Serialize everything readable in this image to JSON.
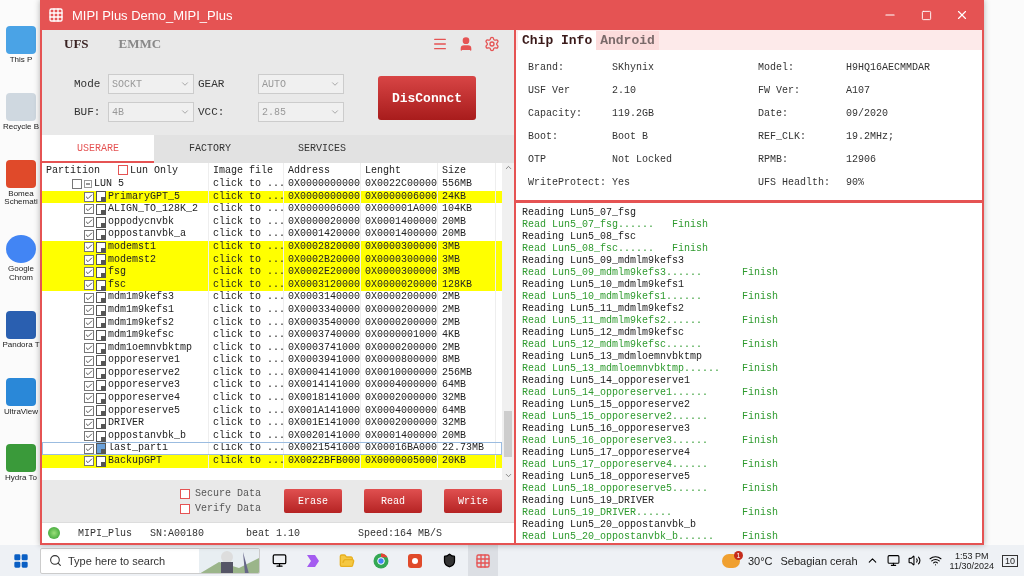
{
  "desktop_icons": [
    {
      "label": "This P"
    },
    {
      "label": "Recycle B"
    },
    {
      "label": "Bomea Schemati"
    },
    {
      "label": "Google Chrom"
    },
    {
      "label": "Pandora T"
    },
    {
      "label": "UltraView"
    },
    {
      "label": "Hydra To"
    }
  ],
  "window": {
    "title": "MIPI Plus Demo_MIPI_Plus"
  },
  "device_tabs": [
    {
      "label": "UFS",
      "selected": true
    },
    {
      "label": "EMMC",
      "selected": false
    }
  ],
  "settings": [
    {
      "label": "Mode",
      "value": "SOCKT",
      "disabled": true
    },
    {
      "label": "GEAR",
      "value": "AUTO",
      "disabled": true
    },
    {
      "label": "BUF:",
      "value": "4B",
      "disabled": true
    },
    {
      "label": "VCC:",
      "value": "2.85",
      "disabled": true
    }
  ],
  "connect_button": "DisConnct",
  "area_tabs": [
    {
      "label": "USERARE",
      "selected": true
    },
    {
      "label": "FACTORY",
      "selected": false
    },
    {
      "label": "SERVICES",
      "selected": false
    }
  ],
  "table": {
    "columns": [
      "Partition",
      "Image file",
      "Address",
      "Lenght",
      "Size"
    ],
    "lun_only": {
      "label": "Lun Only",
      "checked": false
    },
    "lun": {
      "label": "LUN 5",
      "checked": false,
      "expanded": true,
      "image": "click to ...",
      "address": "0X0000000000",
      "length": "0X0022C00000",
      "size": "556MB",
      "children": [
        {
          "name": "PrimaryGPT_5",
          "image": "click to ...",
          "address": "0X0000000000",
          "length": "0X0000006000",
          "size": "24KB",
          "checked": true,
          "highlighted": true,
          "selected": false
        },
        {
          "name": "ALIGN_TO_128K_2",
          "image": "click to ...",
          "address": "0X0000006000",
          "length": "0X000001A000",
          "size": "104KB",
          "checked": true,
          "highlighted": false,
          "selected": false
        },
        {
          "name": "oppodycnvbk",
          "image": "click to ...",
          "address": "0X0000020000",
          "length": "0X0001400000",
          "size": "20MB",
          "checked": true,
          "highlighted": false,
          "selected": false
        },
        {
          "name": "oppostanvbk_a",
          "image": "click to ...",
          "address": "0X0001420000",
          "length": "0X0001400000",
          "size": "20MB",
          "checked": true,
          "highlighted": false,
          "selected": false
        },
        {
          "name": "modemst1",
          "image": "click to ...",
          "address": "0X0002820000",
          "length": "0X0000300000",
          "size": "3MB",
          "checked": true,
          "highlighted": true,
          "selected": false
        },
        {
          "name": "modemst2",
          "image": "click to ...",
          "address": "0X0002B20000",
          "length": "0X0000300000",
          "size": "3MB",
          "checked": true,
          "highlighted": true,
          "selected": false
        },
        {
          "name": "fsg",
          "image": "click to ...",
          "address": "0X0002E20000",
          "length": "0X0000300000",
          "size": "3MB",
          "checked": true,
          "highlighted": true,
          "selected": false
        },
        {
          "name": "fsc",
          "image": "click to ...",
          "address": "0X0003120000",
          "length": "0X0000020000",
          "size": "128KB",
          "checked": true,
          "highlighted": true,
          "selected": false
        },
        {
          "name": "mdm1m9kefs3",
          "image": "click to ...",
          "address": "0X0003140000",
          "length": "0X0000200000",
          "size": "2MB",
          "checked": true,
          "highlighted": false,
          "selected": false
        },
        {
          "name": "mdm1m9kefs1",
          "image": "click to ...",
          "address": "0X0003340000",
          "length": "0X0000200000",
          "size": "2MB",
          "checked": true,
          "highlighted": false,
          "selected": false
        },
        {
          "name": "mdm1m9kefs2",
          "image": "click to ...",
          "address": "0X0003540000",
          "length": "0X0000200000",
          "size": "2MB",
          "checked": true,
          "highlighted": false,
          "selected": false
        },
        {
          "name": "mdm1m9kefsc",
          "image": "click to ...",
          "address": "0X0003740000",
          "length": "0X0000001000",
          "size": "4KB",
          "checked": true,
          "highlighted": false,
          "selected": false
        },
        {
          "name": "mdm1oemnvbktmp",
          "image": "click to ...",
          "address": "0X0003741000",
          "length": "0X0000200000",
          "size": "2MB",
          "checked": true,
          "highlighted": false,
          "selected": false
        },
        {
          "name": "opporeserve1",
          "image": "click to ...",
          "address": "0X0003941000",
          "length": "0X0000800000",
          "size": "8MB",
          "checked": true,
          "highlighted": false,
          "selected": false
        },
        {
          "name": "opporeserve2",
          "image": "click to ...",
          "address": "0X0004141000",
          "length": "0X0010000000",
          "size": "256MB",
          "checked": true,
          "highlighted": false,
          "selected": false
        },
        {
          "name": "opporeserve3",
          "image": "click to ...",
          "address": "0X0014141000",
          "length": "0X0004000000",
          "size": "64MB",
          "checked": true,
          "highlighted": false,
          "selected": false
        },
        {
          "name": "opporeserve4",
          "image": "click to ...",
          "address": "0X0018141000",
          "length": "0X0002000000",
          "size": "32MB",
          "checked": true,
          "highlighted": false,
          "selected": false
        },
        {
          "name": "opporeserve5",
          "image": "click to ...",
          "address": "0X001A141000",
          "length": "0X0004000000",
          "size": "64MB",
          "checked": true,
          "highlighted": false,
          "selected": false
        },
        {
          "name": "DRIVER",
          "image": "click to ...",
          "address": "0X001E141000",
          "length": "0X0002000000",
          "size": "32MB",
          "checked": true,
          "highlighted": false,
          "selected": false
        },
        {
          "name": "oppostanvbk_b",
          "image": "click to ...",
          "address": "0X0020141000",
          "length": "0X0001400000",
          "size": "20MB",
          "checked": true,
          "highlighted": false,
          "selected": false
        },
        {
          "name": "last_parti",
          "image": "click to ...",
          "address": "0X0021541000",
          "length": "0X00016BA000",
          "size": "22.73MB",
          "checked": true,
          "highlighted": false,
          "selected": true
        },
        {
          "name": "BackupGPT",
          "image": "click to ...",
          "address": "0X0022BFB000",
          "length": "0X0000005000",
          "size": "20KB",
          "checked": true,
          "highlighted": true,
          "selected": false
        }
      ]
    }
  },
  "options": [
    {
      "label": "Secure Data",
      "checked": false
    },
    {
      "label": "Verify Data",
      "checked": false
    }
  ],
  "actions": [
    "Erase",
    "Read",
    "Write"
  ],
  "status_bar": {
    "connected": true,
    "device": "MIPI_Plus",
    "serial": "SN:A00180",
    "version": "beat 1.10",
    "speed": "Speed:164 MB/S"
  },
  "info_tabs": [
    {
      "label": "Chip Info",
      "selected": true
    },
    {
      "label": "Android",
      "selected": false
    }
  ],
  "chip_info": [
    {
      "label": "Brand:",
      "value": "SKhynix"
    },
    {
      "label": "Model:",
      "value": "H9HQ16AECMMDAR"
    },
    {
      "label": "USF Ver",
      "value": "2.10"
    },
    {
      "label": "FW Ver:",
      "value": "A107"
    },
    {
      "label": "Capacity:",
      "value": "119.2GB"
    },
    {
      "label": "Date:",
      "value": "09/2020"
    },
    {
      "label": "Boot:",
      "value": "Boot B"
    },
    {
      "label": "REF_CLK:",
      "value": "19.2MHz;"
    },
    {
      "label": "OTP",
      "value": "Not Locked"
    },
    {
      "label": "RPMB:",
      "value": "12906"
    },
    {
      "label": "WriteProtect:",
      "value": "Yes"
    },
    {
      "label": "UFS Headlth:",
      "value": "90%"
    }
  ],
  "log": [
    {
      "kind": "reading",
      "text": "Reading Lun5_07_fsg"
    },
    {
      "kind": "read",
      "text": "Read Lun5_07_fsg......",
      "status": "Finish"
    },
    {
      "kind": "reading",
      "text": "Reading Lun5_08_fsc"
    },
    {
      "kind": "read",
      "text": "Read Lun5_08_fsc......",
      "status": "Finish"
    },
    {
      "kind": "reading",
      "text": "Reading Lun5_09_mdmlm9kefs3"
    },
    {
      "kind": "read",
      "text": "Read Lun5_09_mdmlm9kefs3......",
      "status": "Finish"
    },
    {
      "kind": "reading",
      "text": "Reading Lun5_10_mdmlm9kefs1"
    },
    {
      "kind": "read",
      "text": "Read Lun5_10_mdmlm9kefs1......",
      "status": "Finish"
    },
    {
      "kind": "reading",
      "text": "Reading Lun5_11_mdmlm9kefs2"
    },
    {
      "kind": "read",
      "text": "Read Lun5_11_mdmlm9kefs2......",
      "status": "Finish"
    },
    {
      "kind": "reading",
      "text": "Reading Lun5_12_mdmlm9kefsc"
    },
    {
      "kind": "read",
      "text": "Read Lun5_12_mdmlm9kefsc......",
      "status": "Finish"
    },
    {
      "kind": "reading",
      "text": "Reading Lun5_13_mdmloemnvbktmp"
    },
    {
      "kind": "read",
      "text": "Read Lun5_13_mdmloemnvbktmp......",
      "status": "Finish"
    },
    {
      "kind": "reading",
      "text": "Reading Lun5_14_opporeserve1"
    },
    {
      "kind": "read",
      "text": "Read Lun5_14_opporeserve1......",
      "status": "Finish"
    },
    {
      "kind": "reading",
      "text": "Reading Lun5_15_opporeserve2"
    },
    {
      "kind": "read",
      "text": "Read Lun5_15_opporeserve2......",
      "status": "Finish"
    },
    {
      "kind": "reading",
      "text": "Reading Lun5_16_opporeserve3"
    },
    {
      "kind": "read",
      "text": "Read Lun5_16_opporeserve3......",
      "status": "Finish"
    },
    {
      "kind": "reading",
      "text": "Reading Lun5_17_opporeserve4"
    },
    {
      "kind": "read",
      "text": "Read Lun5_17_opporeserve4......",
      "status": "Finish"
    },
    {
      "kind": "reading",
      "text": "Reading Lun5_18_opporeserve5"
    },
    {
      "kind": "read",
      "text": "Read Lun5_18_opporeserve5......",
      "status": "Finish"
    },
    {
      "kind": "reading",
      "text": "Reading Lun5_19_DRIVER"
    },
    {
      "kind": "read",
      "text": "Read Lun5_19_DRIVER......",
      "status": "Finish"
    },
    {
      "kind": "reading",
      "text": "Reading Lun5_20_oppostanvbk_b"
    },
    {
      "kind": "read",
      "text": "Read Lun5_20_oppostanvbk_b......",
      "status": "Finish"
    }
  ],
  "taskbar": {
    "search_placeholder": "Type here to search",
    "weather": {
      "temperature": "30°C",
      "condition": "Sebagian cerah",
      "alert": "1"
    },
    "time": "1:53 PM",
    "date": "11/30/2024",
    "notifications": "10"
  }
}
